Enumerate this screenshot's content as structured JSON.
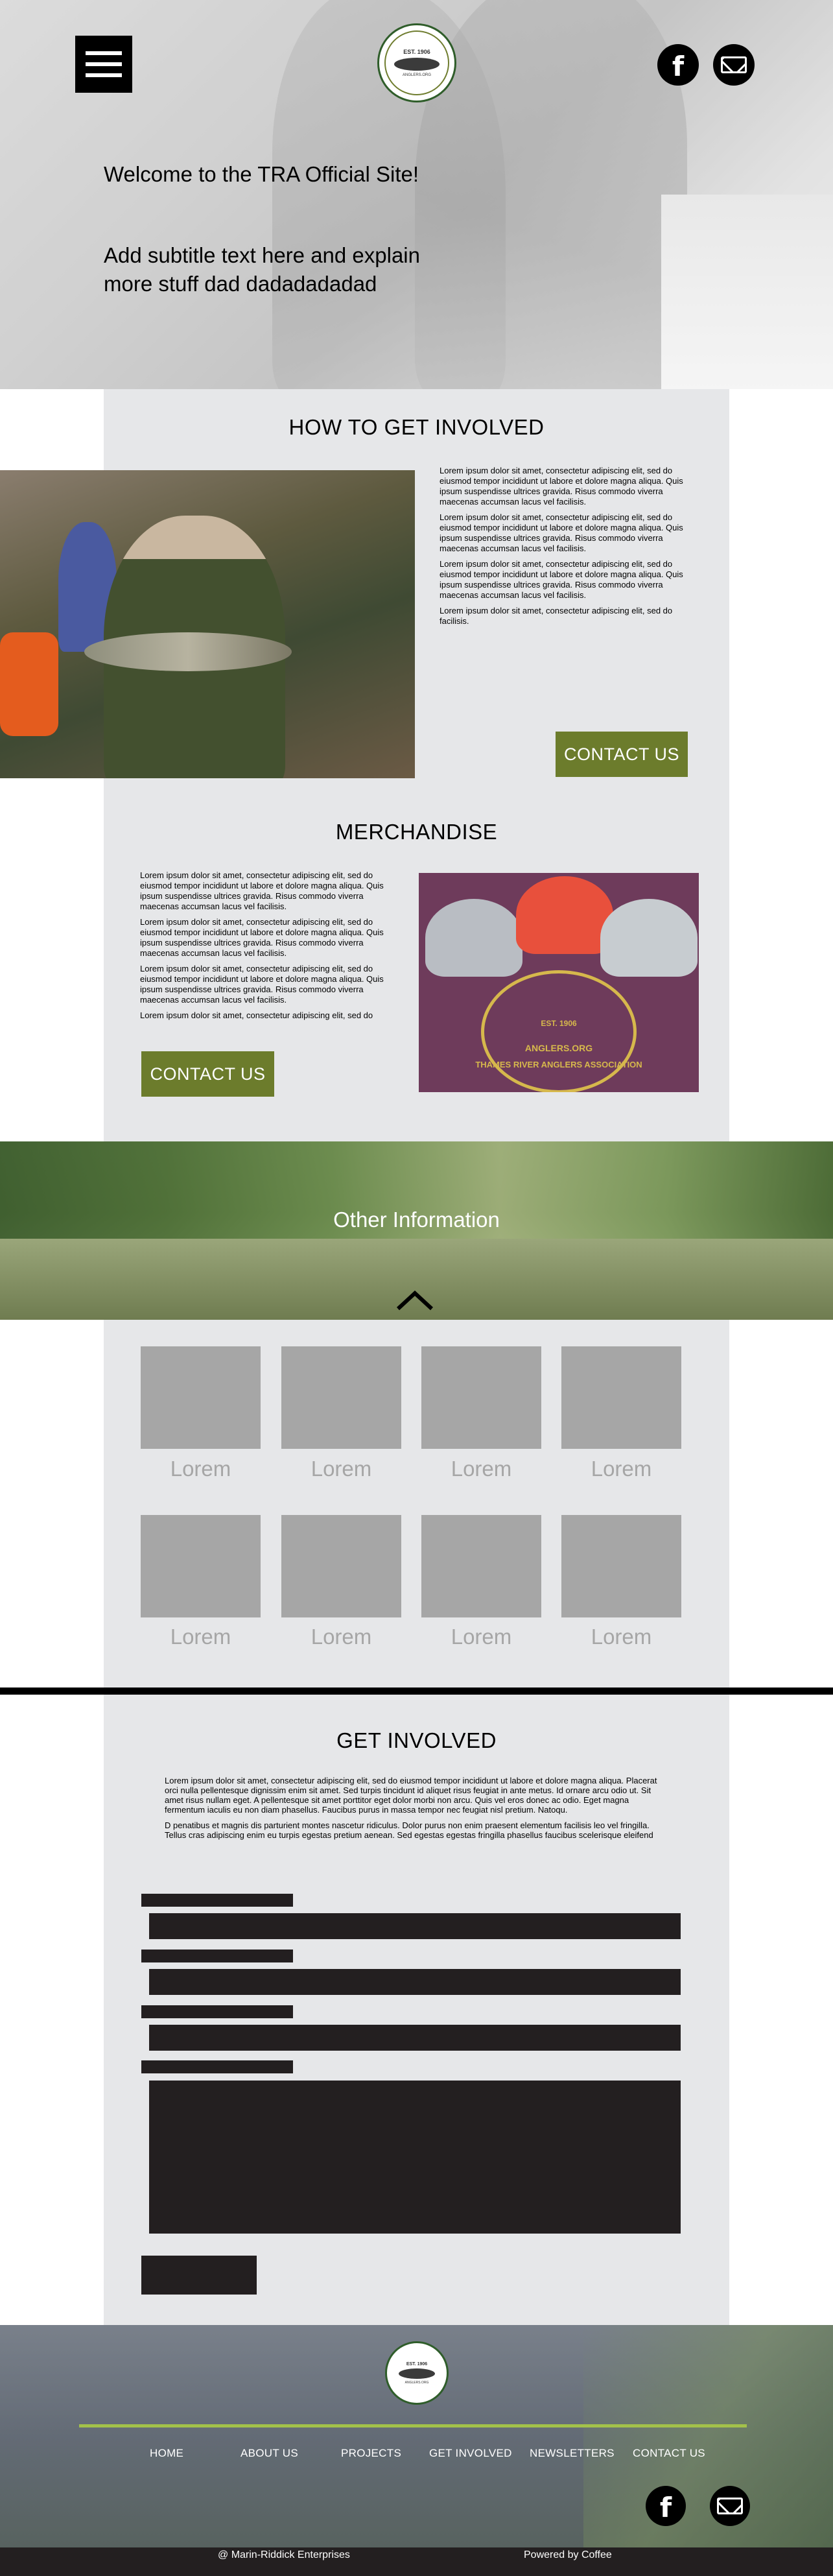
{
  "hero": {
    "title": "Welcome to the TRA Official Site!",
    "subtitle": "Add subtitle text here and explain more stuff dad dadadadadad",
    "menu_icon": "hamburger-menu-icon",
    "logo": {
      "est": "EST. 1906",
      "sub": "ANGLERS.ORG"
    },
    "social": [
      {
        "name": "facebook",
        "icon": "facebook-icon",
        "glyph": "f"
      },
      {
        "name": "email",
        "icon": "mail-icon"
      }
    ]
  },
  "how_to": {
    "title": "HOW TO GET INVOLVED",
    "paragraphs": [
      "Lorem ipsum dolor sit amet, consectetur adipiscing elit, sed do eiusmod tempor incididunt ut labore et dolore magna aliqua. Quis ipsum suspendisse ultrices gravida. Risus commodo viverra maecenas accumsan lacus vel facilisis.",
      "Lorem ipsum dolor sit amet, consectetur adipiscing elit, sed do eiusmod tempor incididunt ut labore et dolore magna aliqua. Quis ipsum suspendisse ultrices gravida. Risus commodo viverra maecenas accumsan lacus vel facilisis.",
      "Lorem ipsum dolor sit amet, consectetur adipiscing elit, sed do eiusmod tempor incididunt ut labore et dolore magna aliqua. Quis ipsum suspendisse ultrices gravida. Risus commodo viverra maecenas accumsan lacus vel facilisis.",
      "Lorem ipsum dolor sit amet, consectetur adipiscing elit, sed do facilisis."
    ],
    "button": "CONTACT US"
  },
  "merch": {
    "title": "MERCHANDISE",
    "paragraphs": [
      "Lorem ipsum dolor sit amet, consectetur adipiscing elit, sed do eiusmod tempor incididunt ut labore et dolore magna aliqua. Quis ipsum suspendisse ultrices gravida. Risus commodo viverra maecenas accumsan lacus vel facilisis.",
      "Lorem ipsum dolor sit amet, consectetur adipiscing elit, sed do eiusmod tempor incididunt ut labore et dolore magna aliqua. Quis ipsum suspendisse ultrices gravida. Risus commodo viverra maecenas accumsan lacus vel facilisis.",
      "Lorem ipsum dolor sit amet, consectetur adipiscing elit, sed do eiusmod tempor incididunt ut labore et dolore magna aliqua. Quis ipsum suspendisse ultrices gravida. Risus commodo viverra maecenas accumsan lacus vel facilisis.",
      "Lorem ipsum dolor sit amet, consectetur adipiscing elit, sed do"
    ],
    "button": "CONTACT US",
    "photo_text": {
      "est": "EST. 1906",
      "site": "ANGLERS.ORG",
      "org": "THAMES RIVER ANGLERS ASSOCIATION"
    }
  },
  "other": {
    "title": "Other Information",
    "up_icon": "chevron-up-icon",
    "tiles": [
      "Lorem",
      "Lorem",
      "Lorem",
      "Lorem",
      "Lorem",
      "Lorem",
      "Lorem",
      "Lorem"
    ]
  },
  "get_involved": {
    "title": "GET INVOLVED",
    "paragraphs": [
      "Lorem ipsum dolor sit amet, consectetur adipiscing elit, sed do eiusmod tempor incididunt ut labore et dolore magna aliqua. Placerat orci nulla pellentesque dignissim enim sit amet. Sed turpis tincidunt id aliquet risus feugiat in ante metus. Id ornare arcu odio ut. Sit amet risus nullam eget. A pellentesque sit amet porttitor eget dolor morbi non arcu. Quis vel eros donec ac odio. Eget magna fermentum iaculis eu non diam phasellus. Faucibus purus in massa tempor nec feugiat nisl pretium. Natoqu.",
      "D penatibus et magnis dis parturient montes nascetur ridiculus. Dolor purus non enim praesent elementum facilisis leo vel fringilla. Tellus cras adipiscing enim eu turpis egestas pretium aenean. Sed egestas egestas fringilla phasellus faucibus scelerisque eleifend"
    ]
  },
  "footer": {
    "logo": {
      "est": "EST. 1906",
      "sub": "ANGLERS.ORG"
    },
    "nav": [
      "HOME",
      "ABOUT US",
      "PROJECTS",
      "GET INVOLVED",
      "NEWSLETTERS",
      "CONTACT US"
    ],
    "rule_color": "#a3c14a",
    "copyright": "@ Marin-Riddick Enterprises",
    "powered": "Powered by Coffee"
  },
  "colors": {
    "accent_green": "#6c7c2c",
    "panel_gray": "#e6e7e9",
    "tile_gray": "#a6a6a6",
    "form_dark": "#231f20"
  }
}
